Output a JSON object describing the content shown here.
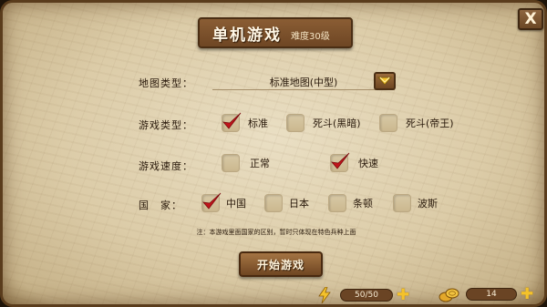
{
  "title": {
    "main": "单机游戏",
    "difficulty": "难度30级"
  },
  "close_label": "X",
  "rows": {
    "map": {
      "label": "地图类型：",
      "selected": "标准地图(中型)"
    },
    "mode": {
      "label": "游戏类型：",
      "options": [
        {
          "label": "标准",
          "checked": true
        },
        {
          "label": "死斗(黑暗)",
          "checked": false
        },
        {
          "label": "死斗(帝王)",
          "checked": false
        }
      ]
    },
    "speed": {
      "label": "游戏速度：",
      "options": [
        {
          "label": "正常",
          "checked": false
        },
        {
          "label": "快速",
          "checked": true
        }
      ]
    },
    "country": {
      "label": "国　家：",
      "options": [
        {
          "label": "中国",
          "checked": true
        },
        {
          "label": "日本",
          "checked": false
        },
        {
          "label": "条顿",
          "checked": false
        },
        {
          "label": "波斯",
          "checked": false
        }
      ]
    }
  },
  "note": "注：本游戏里面国家的区别，暂时只体现在特色兵种上面",
  "start_button": "开始游戏",
  "energy": {
    "value": "50/50",
    "icon": "lightning-icon"
  },
  "gold": {
    "value": "14",
    "icon": "coin-icon"
  },
  "colors": {
    "check_red": "#c0141b",
    "plus_gold": "#f4c22b",
    "wood": "#7a5030"
  }
}
